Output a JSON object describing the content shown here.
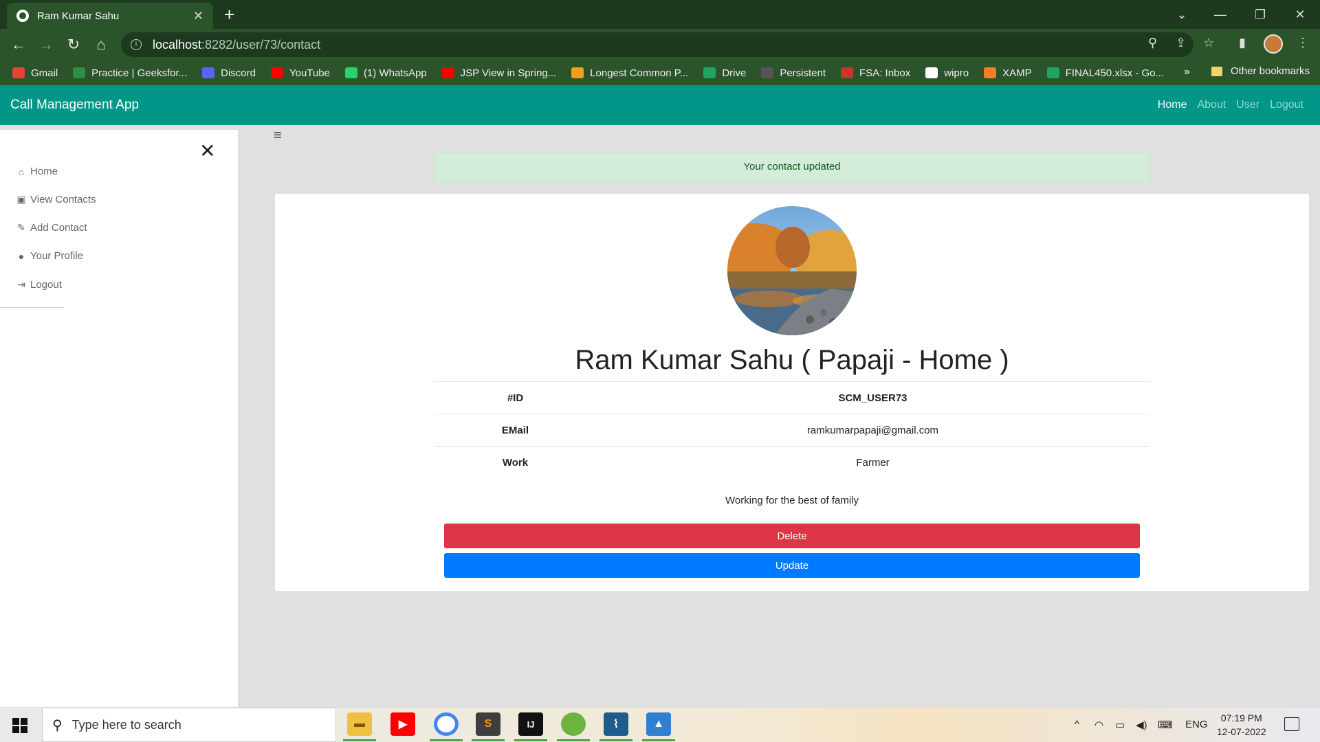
{
  "browser": {
    "tab_title": "Ram Kumar Sahu",
    "tab_close": "✕",
    "new_tab": "+",
    "url_host": "localhost",
    "url_path": ":8282/user/73/contact",
    "bookmarks": [
      {
        "label": "Gmail",
        "color": "#ea4335"
      },
      {
        "label": "Practice | Geeksfor...",
        "color": "#2f8d46"
      },
      {
        "label": "Discord",
        "color": "#5865f2"
      },
      {
        "label": "YouTube",
        "color": "#ff0000"
      },
      {
        "label": "(1) WhatsApp",
        "color": "#25d366"
      },
      {
        "label": "JSP View in Spring...",
        "color": "#ff0000"
      },
      {
        "label": "Longest Common P...",
        "color": "#f0a020"
      },
      {
        "label": "Drive",
        "color": "#1fa463"
      },
      {
        "label": "Persistent",
        "color": "#555555"
      },
      {
        "label": "FSA: Inbox",
        "color": "#c0392b"
      },
      {
        "label": "wipro",
        "color": "#ffffff"
      },
      {
        "label": "XAMP",
        "color": "#fb7a24"
      },
      {
        "label": "FINAL450.xlsx - Go...",
        "color": "#1fa463"
      }
    ],
    "bookmarks_more": "»",
    "other_bookmarks": "Other bookmarks"
  },
  "app": {
    "brand": "Call Management App",
    "nav": [
      "Home",
      "About",
      "User",
      "Logout"
    ],
    "accent_color": "#009688"
  },
  "sidebar": {
    "close": "✕",
    "items": [
      {
        "label": "Home",
        "icon": "home-icon"
      },
      {
        "label": "View Contacts",
        "icon": "address-book-icon"
      },
      {
        "label": "Add Contact",
        "icon": "pencil-icon"
      },
      {
        "label": "Your Profile",
        "icon": "user-circle-icon"
      },
      {
        "label": "Logout",
        "icon": "sign-out-icon"
      }
    ]
  },
  "alert": {
    "message": "Your contact updated"
  },
  "contact": {
    "name": "Ram Kumar Sahu ( Papaji - Home )",
    "rows": [
      {
        "label": "#ID",
        "value": "SCM_USER73"
      },
      {
        "label": "EMail",
        "value": "ramkumarpapaji@gmail.com"
      },
      {
        "label": "Work",
        "value": "Farmer"
      }
    ],
    "description": "Working for the best of family",
    "delete_label": "Delete",
    "update_label": "Update"
  },
  "taskbar": {
    "search_placeholder": "Type here to search",
    "language": "ENG",
    "time": "07:19 PM",
    "date": "12-07-2022"
  }
}
